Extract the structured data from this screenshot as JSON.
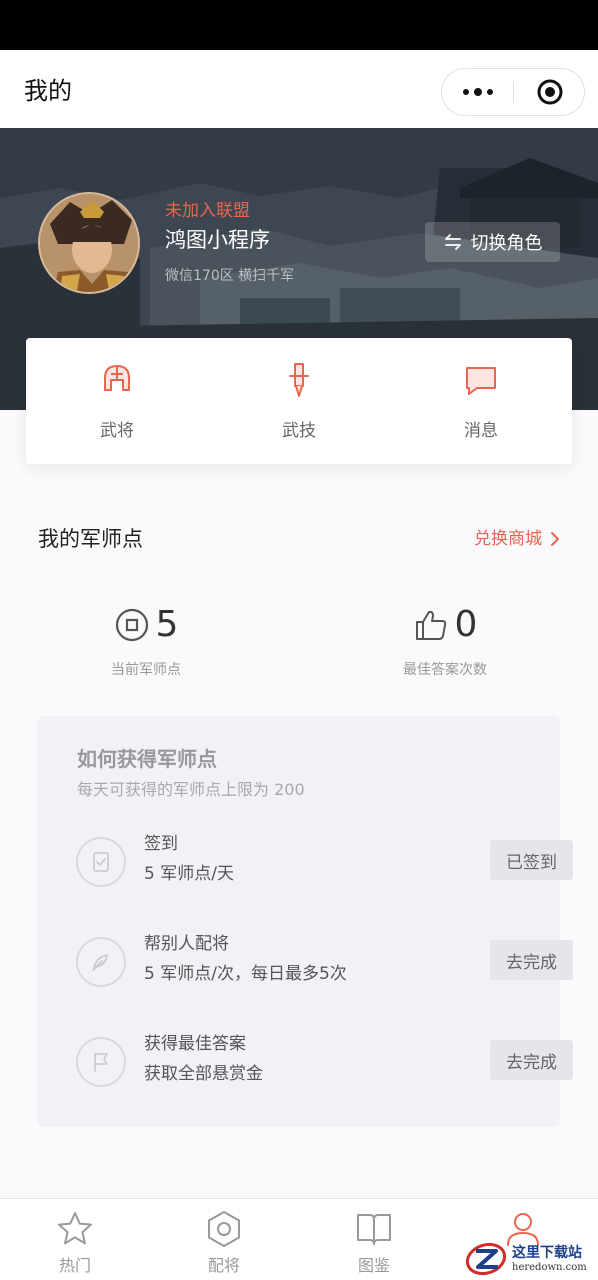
{
  "nav": {
    "title": "我的"
  },
  "profile": {
    "alliance": "未加入联盟",
    "name": "鸿图小程序",
    "server": "微信170区 横扫千军",
    "switch_label": "切换角色"
  },
  "quick_links": [
    {
      "label": "武将",
      "icon": "helmet-icon"
    },
    {
      "label": "武技",
      "icon": "sword-icon"
    },
    {
      "label": "消息",
      "icon": "message-icon"
    }
  ],
  "points": {
    "title": "我的军师点",
    "shop_label": "兑换商城",
    "current_value": "5",
    "current_label": "当前军师点",
    "best_value": "0",
    "best_label": "最佳答案次数"
  },
  "how": {
    "title": "如何获得军师点",
    "subtitle": "每天可获得的军师点上限为 200",
    "tasks": [
      {
        "name": "签到",
        "desc": "5 军师点/天",
        "button": "已签到",
        "icon": "checkin-icon"
      },
      {
        "name": "帮别人配将",
        "desc": "5 军师点/次，每日最多5次",
        "button": "去完成",
        "icon": "feather-icon"
      },
      {
        "name": "获得最佳答案",
        "desc": "获取全部悬赏金",
        "button": "去完成",
        "icon": "flag-icon"
      }
    ]
  },
  "tabs": [
    {
      "label": "热门",
      "icon": "star-icon"
    },
    {
      "label": "配将",
      "icon": "hexagon-icon"
    },
    {
      "label": "图鉴",
      "icon": "book-icon"
    },
    {
      "label": "",
      "icon": "person-icon",
      "active_color": "#e8654f"
    }
  ],
  "watermark": {
    "main": "这里下载站",
    "url": "heredown.com"
  },
  "colors": {
    "accent": "#e8654f",
    "card_bg": "#f3f1f8"
  }
}
